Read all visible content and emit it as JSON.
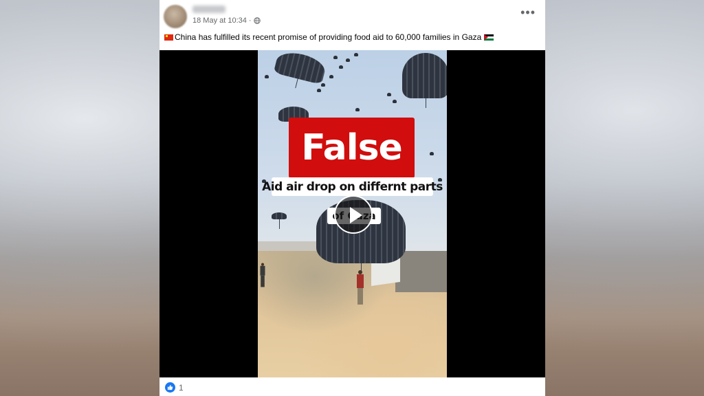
{
  "post": {
    "author_name": "",
    "timestamp": "18 May at 10:34",
    "separator": "·",
    "privacy_icon": "globe-icon",
    "more_icon": "more-options-icon",
    "caption": "China has fulfilled its recent promise of providing food aid to 60,000 families in Gaza",
    "caption_flags": [
      "china-flag",
      "palestine-flag"
    ]
  },
  "video": {
    "rating_label": "False",
    "overlay_line1": "Aid air drop on differnt parts",
    "overlay_line2": "of Gaza",
    "play_icon": "play-icon"
  },
  "reactions": {
    "icon": "like-icon",
    "count": "1"
  },
  "colors": {
    "false_badge": "#d10d0d",
    "like_blue": "#1877f2"
  }
}
